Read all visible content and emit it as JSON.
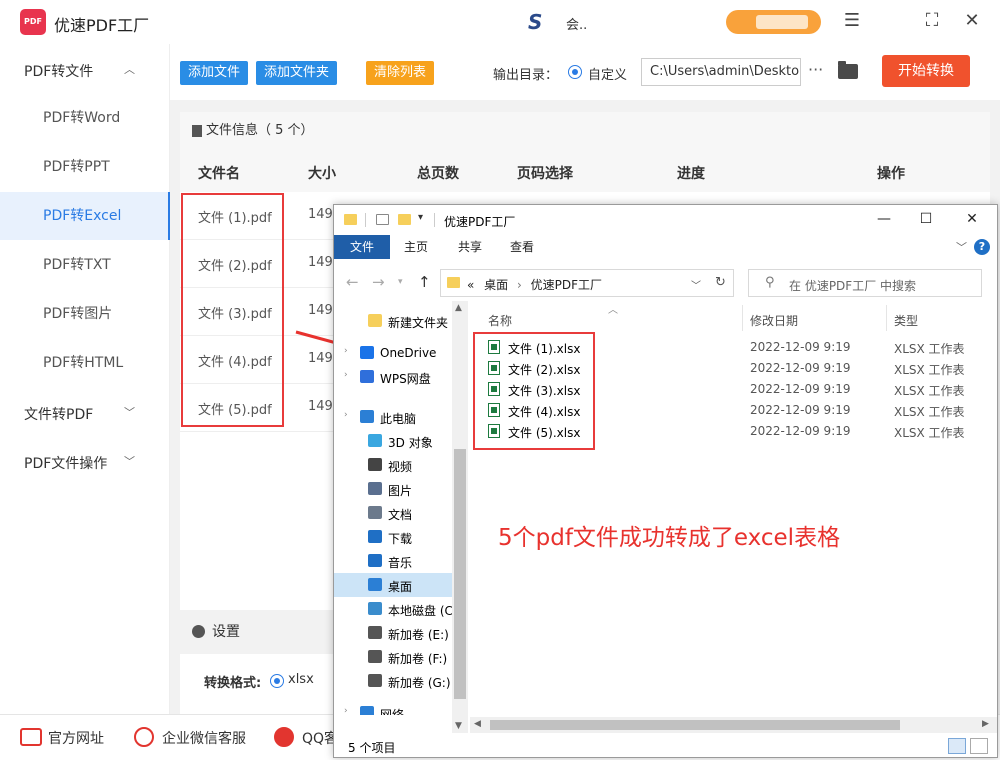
{
  "app": {
    "logo_text": "PDF",
    "title": "优速PDF工厂",
    "user_logo": "S",
    "user_name": "会..",
    "window_buttons": [
      "menu-icon",
      "maximize-icon",
      "close-icon"
    ]
  },
  "sidebar": {
    "groups": [
      {
        "label": "PDF转文件",
        "expanded": true
      },
      {
        "label": "文件转PDF",
        "expanded": false
      },
      {
        "label": "PDF文件操作",
        "expanded": false
      }
    ],
    "items": [
      {
        "label": "PDF转Word"
      },
      {
        "label": "PDF转PPT"
      },
      {
        "label": "PDF转Excel",
        "active": true
      },
      {
        "label": "PDF转TXT"
      },
      {
        "label": "PDF转图片"
      },
      {
        "label": "PDF转HTML"
      }
    ]
  },
  "toolbar": {
    "add_file": "添加文件",
    "add_folder": "添加文件夹",
    "clear_list": "清除列表",
    "output_label": "输出目录：",
    "output_option": "自定义",
    "output_path": "C:\\Users\\admin\\Deskto",
    "more": "···",
    "start": "开始转换"
  },
  "file_list": {
    "header": "文件信息（ 5 个）",
    "columns": [
      "文件名",
      "大小",
      "总页数",
      "页码选择",
      "进度",
      "操作"
    ],
    "rows": [
      {
        "name": "文件 (1).pdf",
        "size": "149."
      },
      {
        "name": "文件 (2).pdf",
        "size": "149."
      },
      {
        "name": "文件 (3).pdf",
        "size": "149."
      },
      {
        "name": "文件 (4).pdf",
        "size": "149."
      },
      {
        "name": "文件 (5).pdf",
        "size": "149."
      }
    ]
  },
  "settings": {
    "title": "设置",
    "format_label": "转换格式:",
    "format_value": "xlsx"
  },
  "footer": {
    "links": [
      "官方网址",
      "企业微信客服",
      "QQ客"
    ]
  },
  "explorer": {
    "title": "优速PDF工厂",
    "tabs": [
      "文件",
      "主页",
      "共享",
      "查看"
    ],
    "help": "?",
    "breadcrumb_prefix": "«",
    "breadcrumb": [
      "桌面",
      "优速PDF工厂"
    ],
    "breadcrumb_sep": "›",
    "search_placeholder": "在 优速PDF工厂 中搜索",
    "nav": [
      {
        "label": "新建文件夹",
        "icon": "folder-icon",
        "color": "#f6cf5b",
        "indent": 34
      },
      {
        "label": "OneDrive",
        "icon": "cloud-icon",
        "color": "#1a73e8",
        "indent": 26
      },
      {
        "label": "WPS网盘",
        "icon": "cloud-icon",
        "color": "#2f6fdb",
        "indent": 26
      },
      {
        "label": "此电脑",
        "icon": "computer-icon",
        "color": "#2b7fd5",
        "indent": 26
      },
      {
        "label": "3D 对象",
        "icon": "cube-icon",
        "color": "#3aa7e0",
        "indent": 34
      },
      {
        "label": "视频",
        "icon": "video-icon",
        "color": "#444444",
        "indent": 34
      },
      {
        "label": "图片",
        "icon": "picture-icon",
        "color": "#5a6f8f",
        "indent": 34
      },
      {
        "label": "文档",
        "icon": "document-icon",
        "color": "#6c7a8c",
        "indent": 34
      },
      {
        "label": "下载",
        "icon": "download-icon",
        "color": "#1f6fc5",
        "indent": 34
      },
      {
        "label": "音乐",
        "icon": "music-icon",
        "color": "#1f6fc5",
        "indent": 34
      },
      {
        "label": "桌面",
        "icon": "desktop-icon",
        "color": "#2b7fd5",
        "indent": 34,
        "selected": true
      },
      {
        "label": "本地磁盘 (C",
        "icon": "disk-icon",
        "color": "#3a8ccc",
        "indent": 34
      },
      {
        "label": "新加卷 (E:)",
        "icon": "disk-icon",
        "color": "#555555",
        "indent": 34
      },
      {
        "label": "新加卷 (F:)",
        "icon": "disk-icon",
        "color": "#555555",
        "indent": 34
      },
      {
        "label": "新加卷 (G:)",
        "icon": "disk-icon",
        "color": "#555555",
        "indent": 34
      },
      {
        "label": "网络",
        "icon": "network-icon",
        "color": "#2b7fd5",
        "indent": 26
      }
    ],
    "columns": [
      "名称",
      "修改日期",
      "类型"
    ],
    "files": [
      {
        "name": "文件 (1).xlsx",
        "date": "2022-12-09 9:19",
        "type": "XLSX 工作表"
      },
      {
        "name": "文件 (2).xlsx",
        "date": "2022-12-09 9:19",
        "type": "XLSX 工作表"
      },
      {
        "name": "文件 (3).xlsx",
        "date": "2022-12-09 9:19",
        "type": "XLSX 工作表"
      },
      {
        "name": "文件 (4).xlsx",
        "date": "2022-12-09 9:19",
        "type": "XLSX 工作表"
      },
      {
        "name": "文件 (5).xlsx",
        "date": "2022-12-09 9:19",
        "type": "XLSX 工作表"
      }
    ],
    "status": "5 个项目"
  },
  "annotation": "5个pdf文件成功转成了excel表格",
  "colors": {
    "accent": "#2a7be4",
    "start_button": "#f0522d",
    "clear_button": "#f7a21c",
    "highlight_red": "#e83b3b",
    "annotation_red": "#e8322e",
    "ribbon_file": "#1f5ea8"
  }
}
